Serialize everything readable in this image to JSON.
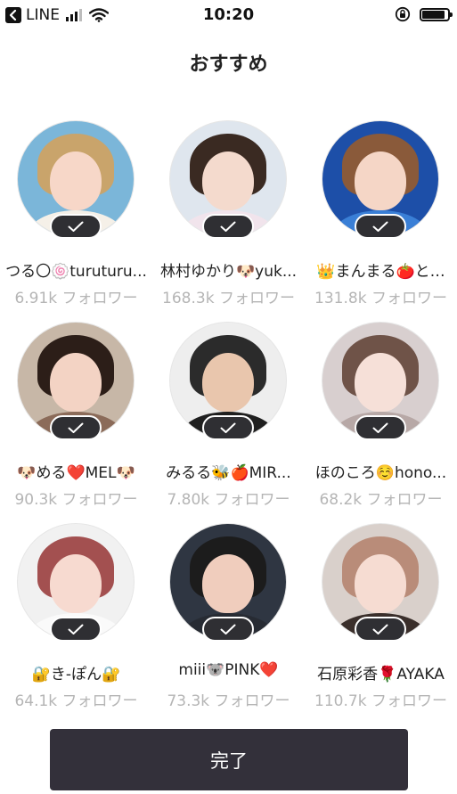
{
  "status_bar": {
    "carrier": "LINE",
    "time": "10:20",
    "battery_level": 0.9
  },
  "header": {
    "title": "おすすめ"
  },
  "recommendations": [
    {
      "name": "つる〇🍥turuturu...",
      "followers": "6.91k フォロワー",
      "selected": true,
      "icon": "avatar-photo"
    },
    {
      "name": "林村ゆかり🐶yuk...",
      "followers": "168.3k フォロワー",
      "selected": true,
      "icon": "avatar-photo"
    },
    {
      "name": "👑まんまる🍅と…",
      "followers": "131.8k フォロワー",
      "selected": true,
      "icon": "avatar-photo"
    },
    {
      "name": "🐶める❤️MEL🐶",
      "followers": "90.3k フォロワー",
      "selected": true,
      "icon": "avatar-photo"
    },
    {
      "name": "みるる🐝🍎MIR...",
      "followers": "7.80k フォロワー",
      "selected": true,
      "icon": "avatar-photo"
    },
    {
      "name": "ほのころ☺️hono...",
      "followers": "68.2k フォロワー",
      "selected": true,
      "icon": "avatar-photo"
    },
    {
      "name": "🔐き-ぽん🔐",
      "followers": "64.1k フォロワー",
      "selected": true,
      "icon": "avatar-photo"
    },
    {
      "name": "miii🐨PINK❤️",
      "followers": "73.3k フォロワー",
      "selected": true,
      "icon": "avatar-photo"
    },
    {
      "name": "石原彩香🌹AYAKA",
      "followers": "110.7k フォロワー",
      "selected": true,
      "icon": "avatar-photo"
    }
  ],
  "footer": {
    "done_label": "完了"
  }
}
